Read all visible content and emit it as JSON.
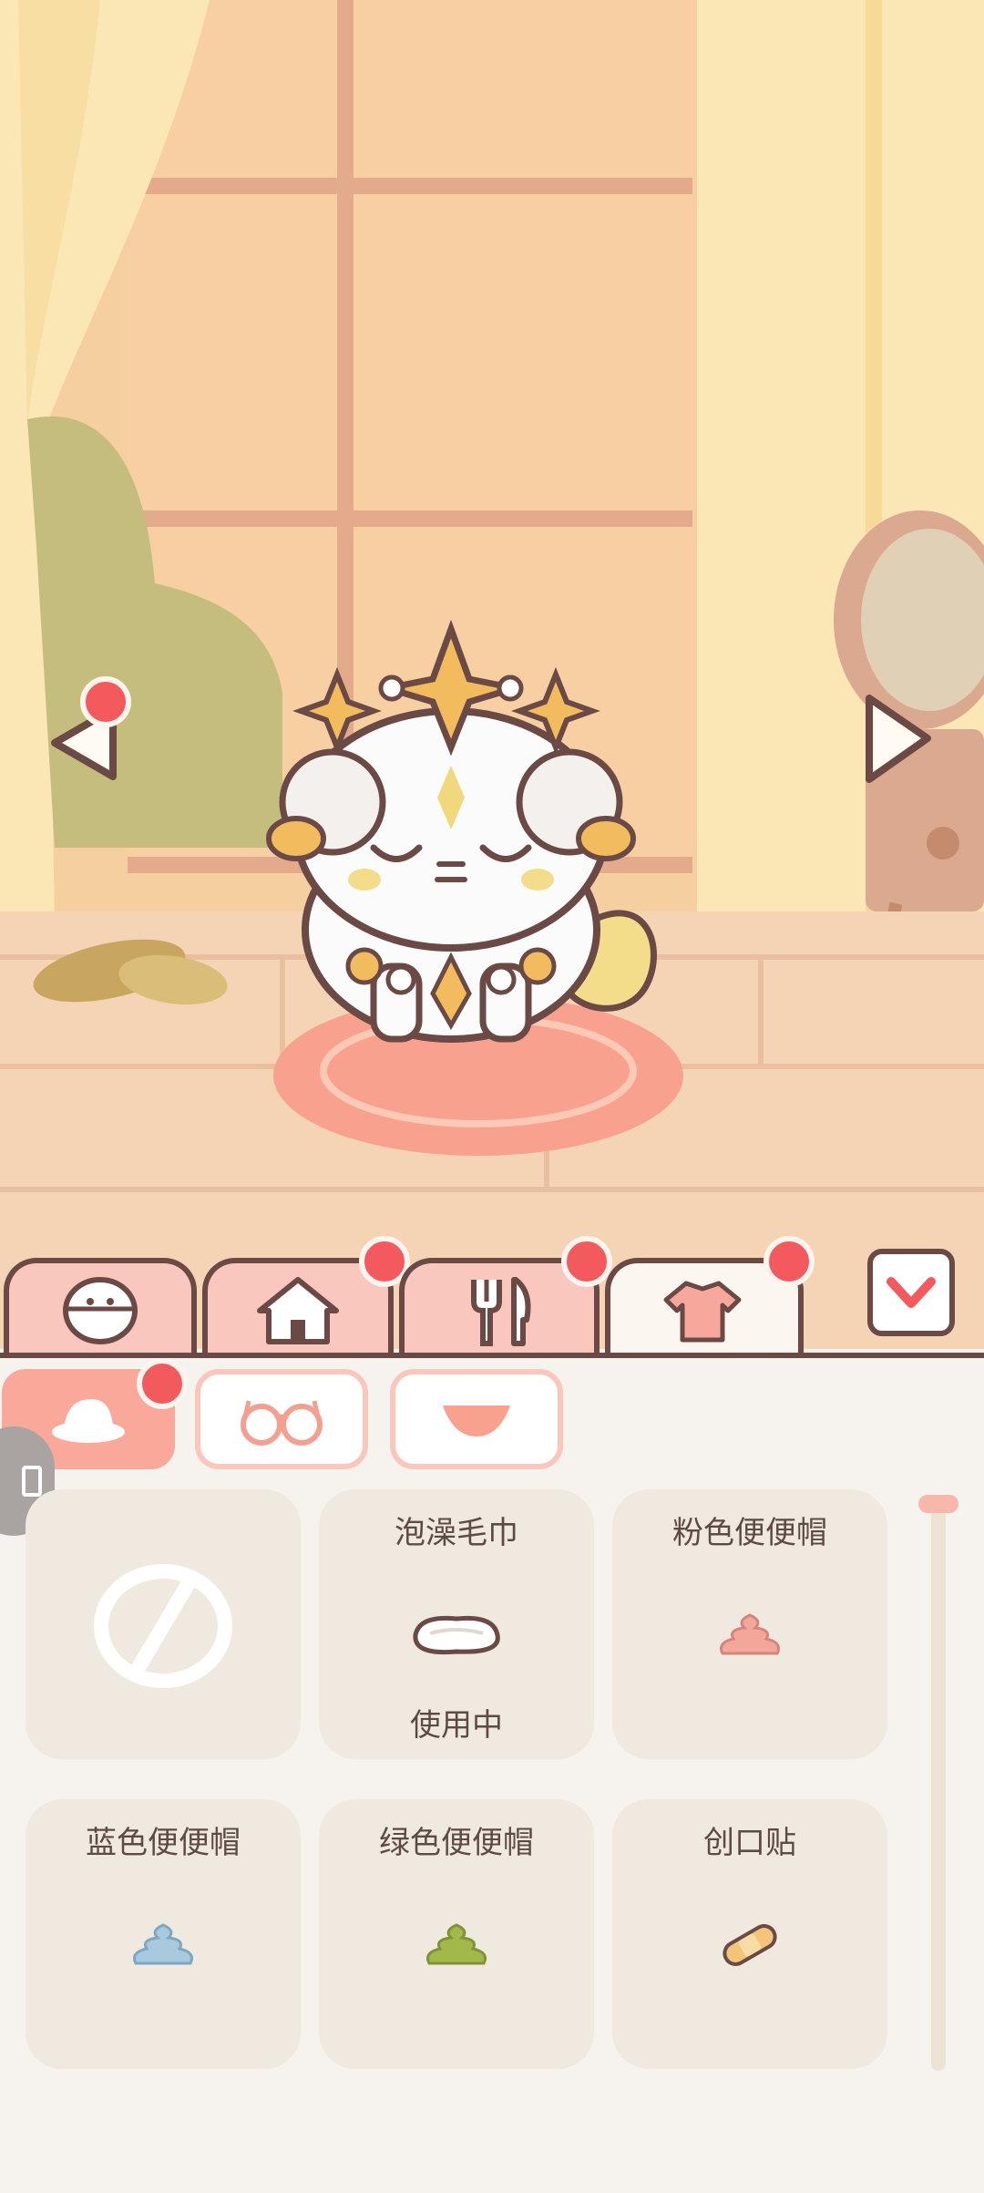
{
  "scene": {
    "prev_arrow_icon": "triangle-left-icon",
    "next_arrow_icon": "triangle-right-icon",
    "pet": "cat-pet"
  },
  "tabs": [
    {
      "icon": "face-icon",
      "active": false,
      "badge": false
    },
    {
      "icon": "house-icon",
      "active": false,
      "badge": true
    },
    {
      "icon": "fork-knife-icon",
      "active": false,
      "badge": true
    },
    {
      "icon": "shirt-icon",
      "active": true,
      "badge": true
    }
  ],
  "collapse_icon": "chevron-down-icon",
  "subtabs": [
    {
      "icon": "hat-icon",
      "active": true,
      "badge": true
    },
    {
      "icon": "glasses-icon",
      "active": false,
      "badge": false
    },
    {
      "icon": "triangle-down-icon",
      "active": false,
      "badge": false
    }
  ],
  "items": [
    {
      "title": "",
      "status": "",
      "icon": "none-icon"
    },
    {
      "title": "泡澡毛巾",
      "status": "使用中",
      "icon": "towel-icon"
    },
    {
      "title": "粉色便便帽",
      "status": "",
      "icon": "pink-poop-hat-icon"
    },
    {
      "title": "蓝色便便帽",
      "status": "",
      "icon": "blue-poop-hat-icon"
    },
    {
      "title": "绿色便便帽",
      "status": "",
      "icon": "green-poop-hat-icon"
    },
    {
      "title": "创口贴",
      "status": "",
      "icon": "bandage-icon"
    }
  ],
  "colors": {
    "accent_red": "#f25a5e",
    "tab_pink": "#f9c7bd",
    "panel_bg": "#f6f3ee",
    "card_bg": "#efe9df",
    "outline": "#6b4a45"
  }
}
